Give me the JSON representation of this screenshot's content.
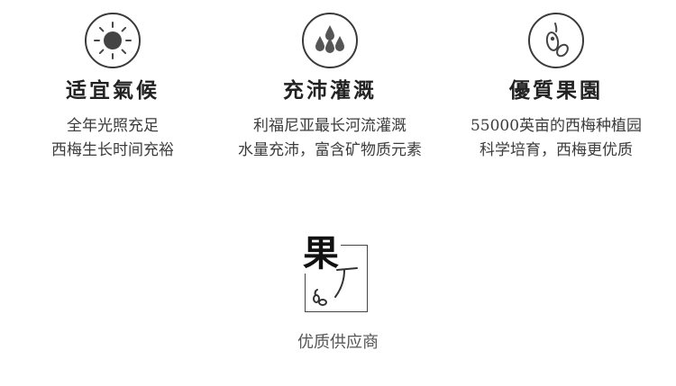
{
  "features": [
    {
      "icon": "sun-icon",
      "title": "适宜氣候",
      "lines": [
        "全年光照充足",
        "西梅生长时间充裕"
      ]
    },
    {
      "icon": "water-drops-icon",
      "title": "充沛灌溉",
      "lines": [
        "利福尼亚最长河流灌溉",
        "水量充沛，富含矿物质元素"
      ]
    },
    {
      "icon": "prune-fruit-icon",
      "title": "優質果園",
      "lines": [
        "55000英亩的西梅种植园",
        "科学培育，西梅更优质"
      ]
    }
  ],
  "logo": {
    "char": "果"
  },
  "supplier": "优质供应商",
  "colors": {
    "ink": "#333333",
    "icon_stroke": "#3a3a3a",
    "icon_fill": "#555555"
  }
}
